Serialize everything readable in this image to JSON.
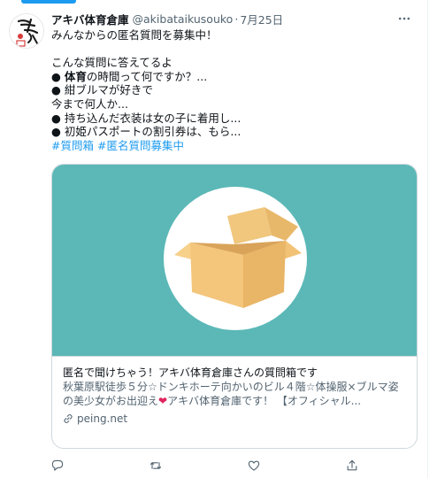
{
  "tweet": {
    "display_name": "アキバ体育倉庫",
    "handle": "@akibataikusouko",
    "separator": "·",
    "date": "7月25日",
    "more_icon": "more-horizontal-icon",
    "avatar_text": "アキバ",
    "lines": [
      "みんなからの匿名質問を募集中！",
      "",
      "こんな質問に答えてるよ",
      "● 体育の時間って何ですか？...",
      "● 紺ブルマが好きで",
      "今まで何人か...",
      "● 持ち込んだ衣装は女の子に着用し...",
      "● 初姫パスポートの割引券は、もら..."
    ],
    "bold_word": "体育",
    "bold_line_rest": "の時間って何ですか？...",
    "bullet": "● ",
    "hashtags": [
      "#質問箱",
      "#匿名質問募集中"
    ]
  },
  "card": {
    "title": "匿名で聞けちゃう！アキバ体育倉庫さんの質問箱です",
    "desc_line1": "秋葉原駅徒歩５分☆ドンキホーテ向かいのビル４階☆体操服×ブルマ姿",
    "desc_line2_a": "の美少女がお出迎え",
    "desc_heart": "❤",
    "desc_line2_b": "アキバ体育倉庫です！ 【オフィシャル...",
    "domain": "peing.net",
    "image_bg": "#5bb8b7",
    "image_icon": "cardboard-box-icon"
  },
  "actions": {
    "reply_icon": "reply-icon",
    "retweet_icon": "retweet-icon",
    "like_icon": "like-heart-icon",
    "share_icon": "share-icon"
  },
  "colors": {
    "accent": "#1d9bf0",
    "text": "#0f1419",
    "secondary": "#536471",
    "border": "#cfd9de"
  }
}
